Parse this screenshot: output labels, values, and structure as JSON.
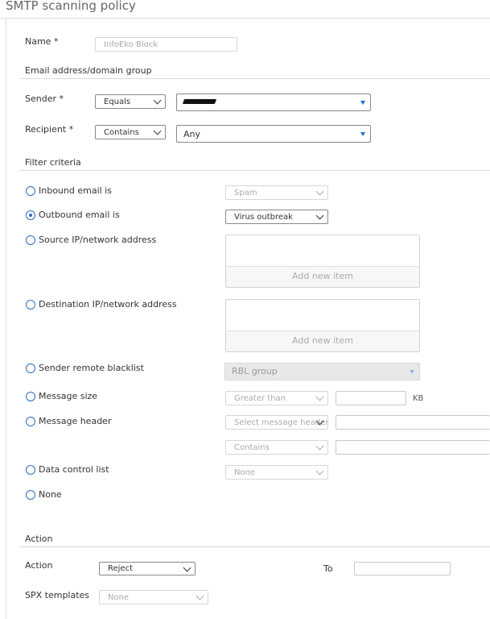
{
  "page": {
    "title": "SMTP scanning policy"
  },
  "name": {
    "label": "Name *",
    "value": "InfoEko Block"
  },
  "email_group": {
    "title": "Email address/domain group",
    "sender": {
      "label": "Sender *",
      "operator": "Equals"
    },
    "recipient": {
      "label": "Recipient *",
      "operator": "Contains",
      "value": "Any"
    }
  },
  "filter": {
    "title": "Filter criteria",
    "inbound": {
      "label": "Inbound email is",
      "value": "Spam"
    },
    "outbound": {
      "label": "Outbound email is",
      "value": "Virus outbreak"
    },
    "source_ip": {
      "label": "Source IP/network address",
      "add": "Add new item"
    },
    "dest_ip": {
      "label": "Destination IP/network address",
      "add": "Add new item"
    },
    "blacklist": {
      "label": "Sender remote blacklist",
      "value": "RBL group"
    },
    "msg_size": {
      "label": "Message size",
      "operator": "Greater than",
      "unit": "KB"
    },
    "msg_header": {
      "label": "Message header",
      "select": "Select message header",
      "operator": "Contains"
    },
    "dcl": {
      "label": "Data control list",
      "value": "None"
    },
    "none": {
      "label": "None"
    }
  },
  "action": {
    "title": "Action",
    "label": "Action",
    "value": "Reject",
    "to_label": "To",
    "spx_label": "SPX templates",
    "spx_value": "None"
  },
  "colors": {
    "accent": "#2a6fc0",
    "dropdown_triangle": "#1a73c8"
  }
}
